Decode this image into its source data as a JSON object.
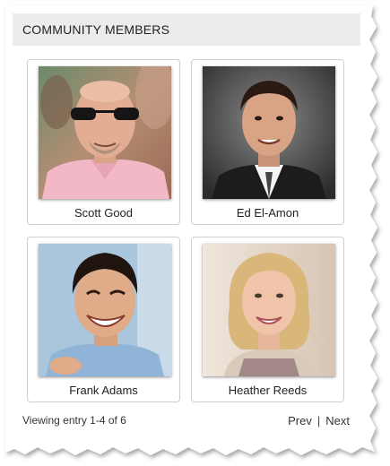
{
  "widget": {
    "title": "COMMUNITY MEMBERS"
  },
  "members": [
    {
      "name": "Scott Good"
    },
    {
      "name": "Ed El-Amon"
    },
    {
      "name": "Frank Adams"
    },
    {
      "name": "Heather Reeds"
    }
  ],
  "footer": {
    "viewing_text": "Viewing entry 1-4 of 6",
    "prev_label": "Prev",
    "separator": "|",
    "next_label": "Next"
  }
}
